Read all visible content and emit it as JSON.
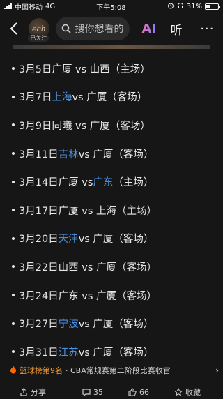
{
  "status_bar": {
    "carrier": "中国移动",
    "network": "4G",
    "time": "下午5:08",
    "battery": "31%",
    "battery_level": 0.31
  },
  "nav": {
    "followed_label": "已关注",
    "search_placeholder": "搜你想看的",
    "ai_label": "AI",
    "listen_label": "听",
    "more_label": "···"
  },
  "schedule": [
    {
      "pre": "3月5日广厦 vs 山西（主场）",
      "link": "",
      "post": ""
    },
    {
      "pre": "3月7日",
      "link": "上海",
      "post": " vs 广厦（客场）"
    },
    {
      "pre": "3月9日同曦 vs 广厦（客场）",
      "link": "",
      "post": ""
    },
    {
      "pre": "3月11日",
      "link": "吉林",
      "post": " vs 广厦（客场）"
    },
    {
      "pre": "3月14日广厦 vs ",
      "link": "广东",
      "post": "（主场）"
    },
    {
      "pre": "3月17日广厦 vs 上海（主场）",
      "link": "",
      "post": ""
    },
    {
      "pre": "3月20日",
      "link": "天津",
      "post": " vs 广厦（客场）"
    },
    {
      "pre": "3月22日山西 vs 广厦（客场）",
      "link": "",
      "post": ""
    },
    {
      "pre": "3月24日广东 vs 广厦（客场）",
      "link": "",
      "post": ""
    },
    {
      "pre": "3月27日",
      "link": "宁波",
      "post": " vs 广厦（客场）"
    },
    {
      "pre": "3月31日",
      "link": "江苏",
      "post": " vs 广厦（客场）"
    }
  ],
  "hot": {
    "rank": "篮球榜第9名",
    "title": "· CBA常规赛第二阶段比赛收官",
    "arrow": "›"
  },
  "actions": {
    "share": "分享",
    "comments": "35",
    "likes": "66",
    "collect": "收藏"
  },
  "colors": {
    "link": "#4a90e2",
    "hot_rank": "#f29a38",
    "background": "#161616"
  }
}
